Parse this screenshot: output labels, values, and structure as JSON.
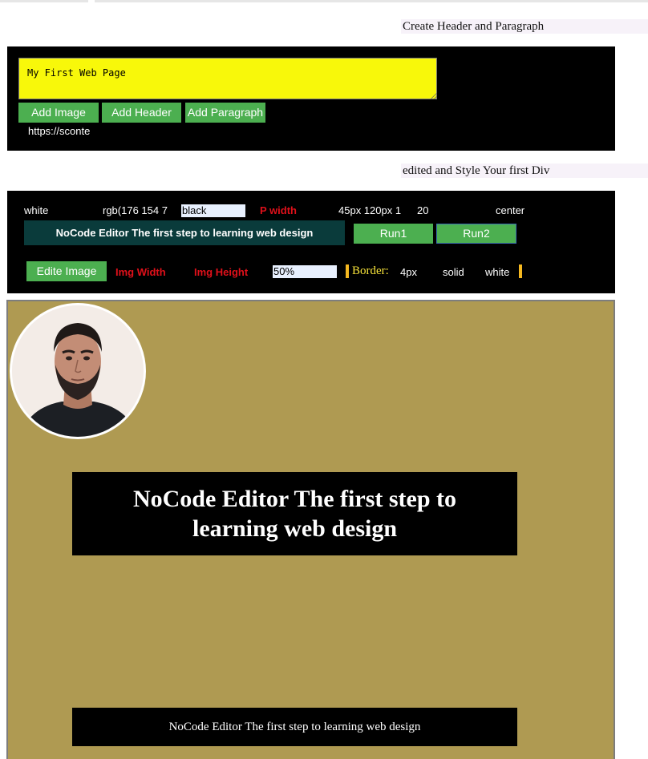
{
  "top_section": {
    "title": "Create Header and Paragraph",
    "textarea_value": "My First Web Page",
    "buttons": {
      "add_image": "Add Image",
      "add_header": "Add Header",
      "add_paragraph": "Add Paragraph"
    },
    "url_text": "https://sconte"
  },
  "style_section": {
    "title": "edited and Style Your first Div",
    "row1": {
      "color_text": "white",
      "background_value": "rgb(176 154 7",
      "font_color_input": "black",
      "p_width_label": "P width",
      "padding_value": "45px 120px 1",
      "font_size_value": "20",
      "align_value": "center"
    },
    "row2": {
      "preview_text": "NoCode Editor The first step to learning web design",
      "run1": "Run1",
      "run2": "Run2"
    },
    "row3": {
      "edit_image_button": "Edite Image",
      "img_width_label": "Img Width",
      "img_height_label": "Img Height",
      "radius_input": "50%",
      "border_label": "Border:",
      "border_width": "4px",
      "border_style": "solid",
      "border_color": "white"
    }
  },
  "preview": {
    "header_text": "NoCode Editor The first step to learning web design",
    "paragraph_text": "NoCode Editor The first step to learning web design"
  },
  "colors": {
    "panel_bg": "#000000",
    "textarea_bg": "#f8f80a",
    "button_green": "#4caf50",
    "preview_bg": "#af9a52",
    "teal_bar": "#0a3b3b",
    "label_red": "#e0101a",
    "accent_yellow": "#f5b820"
  }
}
